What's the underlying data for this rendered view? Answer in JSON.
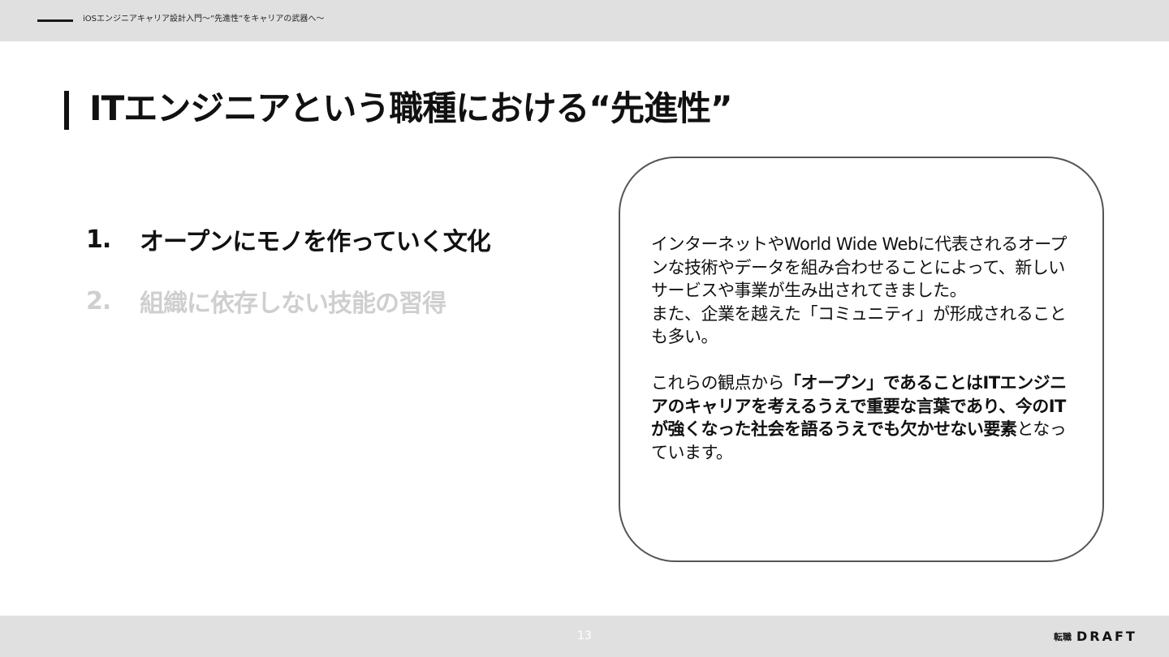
{
  "header": {
    "deck_title": "iOSエンジニアキャリア設計入門〜”先進性”をキャリアの武器へ〜"
  },
  "slide": {
    "title": "ITエンジニアという職種における“先進性”",
    "agenda": [
      {
        "number": "1.",
        "label": "オープンにモノを作っていく文化",
        "state": "active"
      },
      {
        "number": "2.",
        "label": "組織に依存しない技能の習得",
        "state": "inactive"
      }
    ],
    "card": {
      "paragraph1": "インターネットやWorld Wide Webに代表されるオープンな技術やデータを組み合わせることによって、新しいサービスや事業が生み出されてきました。",
      "paragraph2": "また、企業を越えた「コミュニティ」が形成されることも多い。",
      "paragraph3_lead": "これらの観点から",
      "paragraph3_bold": "「オープン」であることはITエンジニアのキャリアを考えるうえで重要な言葉であり、今のITが強くなった社会を語るうえでも欠かせない要素",
      "paragraph3_tail": "となっています。"
    }
  },
  "footer": {
    "page_number": "13",
    "logo_jp": "転職",
    "logo_en": "DRAFT"
  },
  "colors": {
    "bar_gray": "#e0e0e0",
    "text_dark": "#111111",
    "inactive_gray": "#cfcfcf",
    "card_border": "#555555"
  }
}
